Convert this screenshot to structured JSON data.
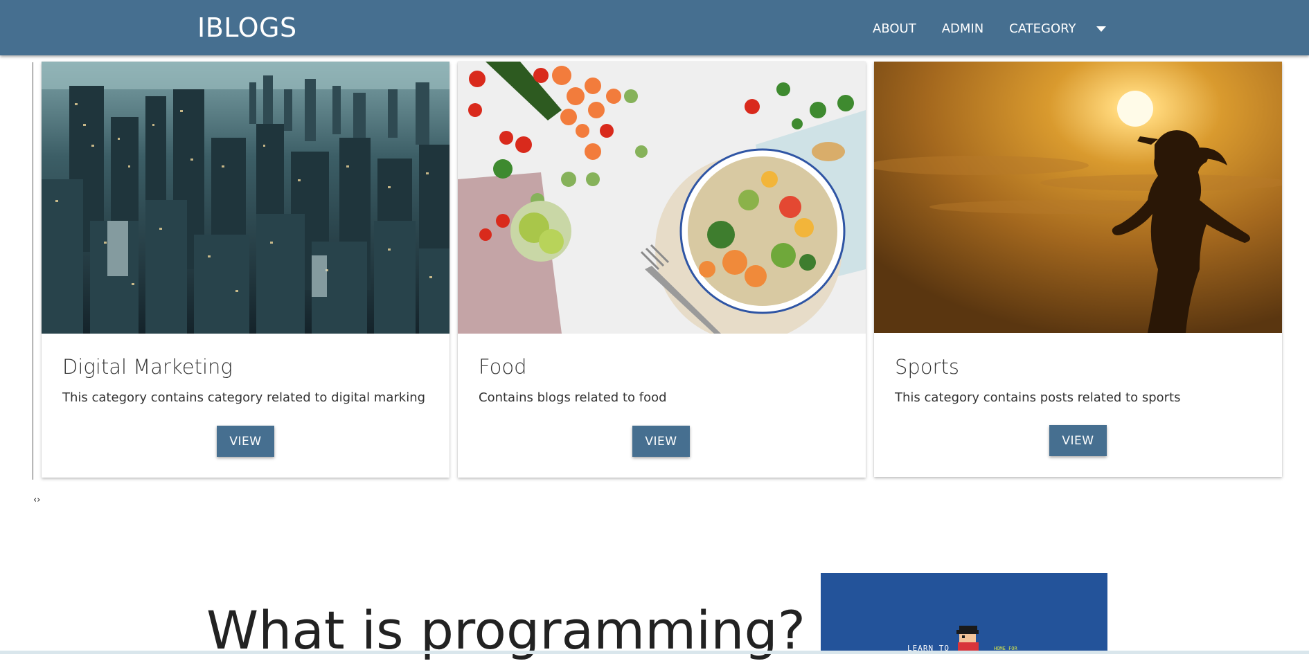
{
  "navbar": {
    "brand": "IBLOGS",
    "links": [
      "ABOUT",
      "ADMIN",
      "CATEGORY"
    ],
    "background": "#466f90"
  },
  "categories": [
    {
      "title": "Digital Marketing",
      "description": "This category contains category related to digital marking",
      "button": "VIEW",
      "image": "city-aerial-photo"
    },
    {
      "title": "Food",
      "description": "Contains blogs related to food",
      "button": "VIEW",
      "image": "healthy-food-bowl-photo"
    },
    {
      "title": "Sports",
      "description": "This category contains posts related to sports",
      "button": "VIEW",
      "image": "runner-sunset-photo"
    }
  ],
  "carousel": {
    "controls": "‹›"
  },
  "article": {
    "heading": "What is programming?",
    "promo_text": "LEARN TO",
    "promo_sub": "HOME FOR"
  }
}
